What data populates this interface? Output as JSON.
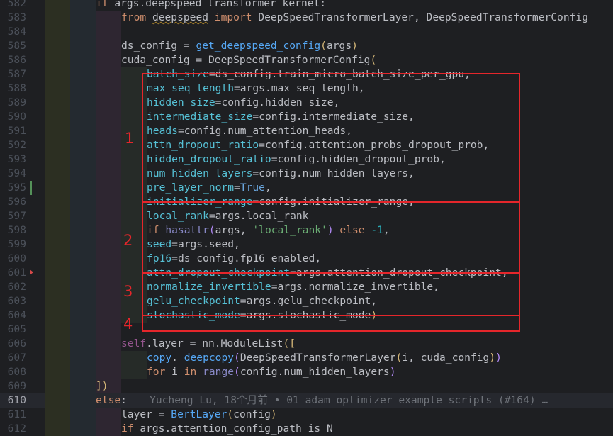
{
  "colors": {
    "background": "#1e1f22",
    "keyword": "#cf8e6d",
    "function": "#56a8f5",
    "string": "#6aab73",
    "number": "#2aacb8",
    "annotation_box": "#e5262b",
    "change_marker": "#549159"
  },
  "editor": {
    "current_line": 610,
    "lines": [
      {
        "n": "582",
        "segs": [
          [
            "kw",
            "if "
          ],
          [
            "",
            "args.deepspeed_transformer_kernel:"
          ]
        ]
      },
      {
        "n": "583",
        "segs": [
          [
            "kw",
            "from "
          ],
          [
            "under",
            "deepspeed"
          ],
          [
            "kw",
            " import "
          ],
          [
            "",
            "DeepSpeedTransformerLayer, DeepSpeedTransformerConfig"
          ]
        ]
      },
      {
        "n": "584",
        "segs": []
      },
      {
        "n": "585",
        "segs": [
          [
            "",
            "ds_config = "
          ],
          [
            "fn",
            "get_deepspeed_config"
          ],
          [
            "paren",
            "("
          ],
          [
            "",
            "args"
          ],
          [
            "paren",
            ")"
          ]
        ]
      },
      {
        "n": "586",
        "segs": [
          [
            "",
            "cuda_config = DeepSpeedTransformerConfig"
          ],
          [
            "paren",
            "("
          ]
        ]
      },
      {
        "n": "587",
        "segs": [
          [
            "param",
            "batch_size"
          ],
          [
            "",
            "=ds_config.train_micro_batch_size_per_gpu,"
          ]
        ]
      },
      {
        "n": "588",
        "segs": [
          [
            "param",
            "max_seq_length"
          ],
          [
            "",
            "=args.max_seq_length,"
          ]
        ]
      },
      {
        "n": "589",
        "segs": [
          [
            "param",
            "hidden_size"
          ],
          [
            "",
            "=config.hidden_size,"
          ]
        ]
      },
      {
        "n": "590",
        "segs": [
          [
            "param",
            "intermediate_size"
          ],
          [
            "",
            "=config.intermediate_size,"
          ]
        ]
      },
      {
        "n": "591",
        "segs": [
          [
            "param",
            "heads"
          ],
          [
            "",
            "=config.num_attention_heads,"
          ]
        ]
      },
      {
        "n": "592",
        "segs": [
          [
            "param",
            "attn_dropout_ratio"
          ],
          [
            "",
            "=config.attention_probs_dropout_prob,"
          ]
        ]
      },
      {
        "n": "593",
        "segs": [
          [
            "param",
            "hidden_dropout_ratio"
          ],
          [
            "",
            "=config.hidden_dropout_prob,"
          ]
        ]
      },
      {
        "n": "594",
        "segs": [
          [
            "param",
            "num_hidden_layers"
          ],
          [
            "",
            "=config.num_hidden_layers,"
          ]
        ]
      },
      {
        "n": "595",
        "segs": [
          [
            "param",
            "pre_layer_norm"
          ],
          [
            "",
            "="
          ],
          [
            "bool",
            "True"
          ],
          [
            "",
            ","
          ]
        ]
      },
      {
        "n": "596",
        "segs": [
          [
            "param",
            "initializer_range"
          ],
          [
            "",
            "=config.initializer_range,"
          ]
        ]
      },
      {
        "n": "597",
        "segs": [
          [
            "param",
            "local_rank"
          ],
          [
            "",
            "=args.local_rank"
          ]
        ]
      },
      {
        "n": "598",
        "segs": [
          [
            "kw",
            "if "
          ],
          [
            "blt",
            "hasattr"
          ],
          [
            "paren2",
            "("
          ],
          [
            "",
            "args, "
          ],
          [
            "str",
            "'local_rank'"
          ],
          [
            "paren2",
            ")"
          ],
          [
            "kw",
            " else "
          ],
          [
            "num",
            "-1"
          ],
          [
            "",
            ","
          ]
        ]
      },
      {
        "n": "599",
        "segs": [
          [
            "param",
            "seed"
          ],
          [
            "",
            "=args.seed,"
          ]
        ]
      },
      {
        "n": "600",
        "segs": [
          [
            "param",
            "fp16"
          ],
          [
            "",
            "=ds_config.fp16_enabled,"
          ]
        ]
      },
      {
        "n": "601",
        "segs": [
          [
            "param",
            "attn_dropout_checkpoint"
          ],
          [
            "",
            "=args.attention_dropout_checkpoint,"
          ]
        ]
      },
      {
        "n": "602",
        "segs": [
          [
            "param",
            "normalize_invertible"
          ],
          [
            "",
            "=args.normalize_invertible,"
          ]
        ]
      },
      {
        "n": "603",
        "segs": [
          [
            "param",
            "gelu_checkpoint"
          ],
          [
            "",
            "=args.gelu_checkpoint,"
          ]
        ]
      },
      {
        "n": "604",
        "segs": [
          [
            "param",
            "stochastic_mode"
          ],
          [
            "",
            "=args.stochastic_mode"
          ],
          [
            "paren",
            ")"
          ]
        ]
      },
      {
        "n": "605",
        "segs": []
      },
      {
        "n": "606",
        "segs": [
          [
            "self",
            "self"
          ],
          [
            "",
            ".layer = nn.ModuleList"
          ],
          [
            "paren",
            "(["
          ]
        ]
      },
      {
        "n": "607",
        "segs": [
          [
            "fn",
            "copy"
          ],
          [
            "",
            ". "
          ],
          [
            "fn",
            "deepcopy"
          ],
          [
            "paren2",
            "("
          ],
          [
            "",
            "DeepSpeedTransformerLayer"
          ],
          [
            "paren",
            "("
          ],
          [
            "",
            "i, cuda_config"
          ],
          [
            "paren",
            ")"
          ],
          [
            "paren2",
            ")"
          ]
        ]
      },
      {
        "n": "608",
        "segs": [
          [
            "kw",
            "for "
          ],
          [
            "",
            "i "
          ],
          [
            "kw",
            "in "
          ],
          [
            "blt",
            "range"
          ],
          [
            "paren2",
            "("
          ],
          [
            "",
            "config.num_hidden_layers"
          ],
          [
            "paren2",
            ")"
          ]
        ]
      },
      {
        "n": "609",
        "segs": [
          [
            "paren",
            "])"
          ]
        ]
      },
      {
        "n": "610",
        "segs": [
          [
            "kw",
            "else"
          ],
          [
            "",
            ":"
          ],
          [
            "blame",
            "Yucheng Lu, 18个月前 • 01 adam optimizer example scripts (#164) …"
          ]
        ]
      },
      {
        "n": "611",
        "segs": [
          [
            "",
            "layer = "
          ],
          [
            "fn",
            "BertLayer"
          ],
          [
            "paren",
            "("
          ],
          [
            "",
            "config"
          ],
          [
            "paren",
            ")"
          ]
        ]
      },
      {
        "n": "612",
        "segs": [
          [
            "kw",
            "if "
          ],
          [
            "",
            "args.attention_config_path is N"
          ]
        ]
      }
    ]
  },
  "annotations": [
    {
      "label": "1",
      "from": "587",
      "to": "595"
    },
    {
      "label": "2",
      "from": "596",
      "to": "600"
    },
    {
      "label": "3",
      "from": "601",
      "to": "603"
    },
    {
      "label": "4",
      "from": "604",
      "to": "604"
    }
  ]
}
